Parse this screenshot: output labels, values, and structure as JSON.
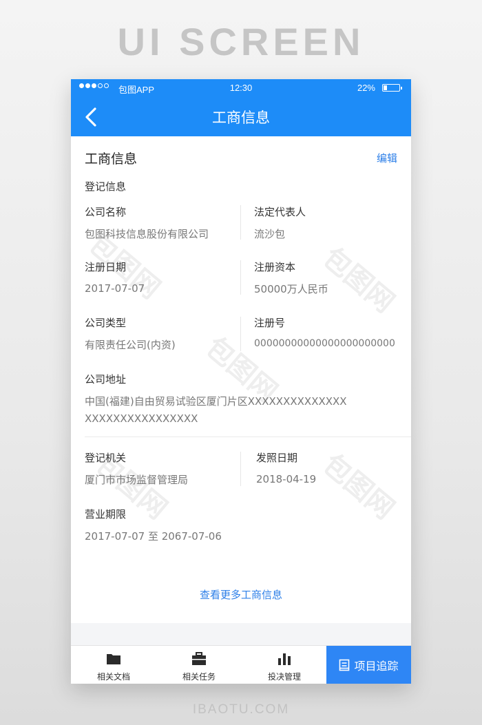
{
  "page": {
    "heading": "UI SCREEN",
    "footer": "IBAOTU.COM"
  },
  "status_bar": {
    "carrier": "包图APP",
    "time": "12:30",
    "battery": "22%"
  },
  "nav": {
    "title": "工商信息"
  },
  "card": {
    "title": "工商信息",
    "edit": "编辑",
    "section": "登记信息",
    "fields": {
      "company_name": {
        "label": "公司名称",
        "value": "包图科技信息股份有限公司"
      },
      "legal_rep": {
        "label": "法定代表人",
        "value": "流沙包"
      },
      "reg_date": {
        "label": "注册日期",
        "value": "2017-07-07"
      },
      "reg_capital": {
        "label": "注册资本",
        "value": "50000万人民币"
      },
      "company_type": {
        "label": "公司类型",
        "value": "有限责任公司(内资)"
      },
      "reg_number": {
        "label": "注册号",
        "value": "00000000000000000000000"
      },
      "address": {
        "label": "公司地址",
        "value_line1": "中国(福建)自由贸易试验区厦门片区XXXXXXXXXXXXXX",
        "value_line2": "XXXXXXXXXXXXXXXX"
      },
      "authority": {
        "label": "登记机关",
        "value": "厦门市市场监督管理局"
      },
      "issue_date": {
        "label": "发照日期",
        "value": "2018-04-19"
      },
      "term": {
        "label": "营业期限",
        "value": "2017-07-07 至 2067-07-06"
      }
    },
    "more": "查看更多工商信息"
  },
  "tabbar": {
    "items": [
      {
        "label": "相关文档",
        "icon": "folder-icon"
      },
      {
        "label": "相关任务",
        "icon": "briefcase-icon"
      },
      {
        "label": "投决管理",
        "icon": "bar-chart-icon"
      }
    ],
    "primary": {
      "label": "项目追踪",
      "icon": "clipboard-icon"
    }
  },
  "watermark": "包图网",
  "colors": {
    "brand": "#1d8cf8",
    "link": "#2d7fe8",
    "primary_button": "#2e86f5"
  }
}
